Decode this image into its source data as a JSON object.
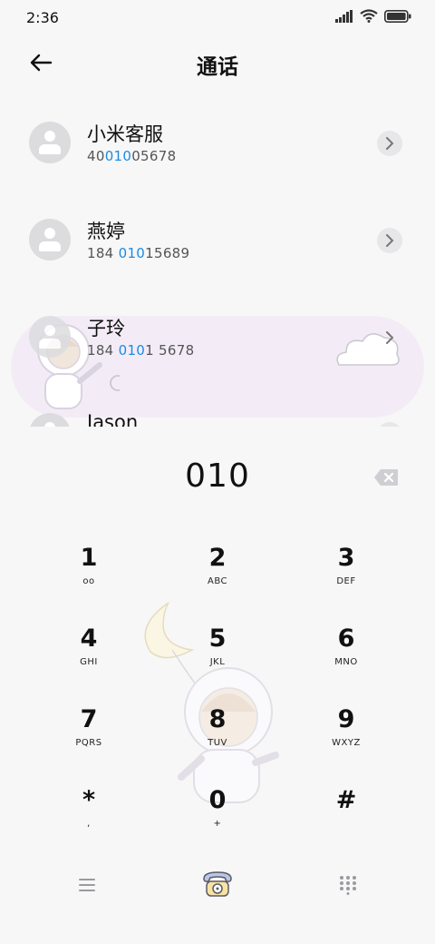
{
  "status": {
    "time": "2:36"
  },
  "header": {
    "title": "通话"
  },
  "contacts": [
    {
      "name": "小米客服",
      "number_pre": "40",
      "number_hl": "010",
      "number_post": "05678"
    },
    {
      "name": "燕婷",
      "number_pre": "184 ",
      "number_hl": "010",
      "number_post": "15689"
    },
    {
      "name": "子玲",
      "number_pre": "184 ",
      "number_hl": "010",
      "number_post": "1 5678"
    },
    {
      "name": "Jason",
      "number_pre": "",
      "number_hl": "",
      "number_post": ""
    }
  ],
  "dial": {
    "digits": "010"
  },
  "keypad": [
    {
      "num": "1",
      "letters": "ᴏᴏ"
    },
    {
      "num": "2",
      "letters": "ABC"
    },
    {
      "num": "3",
      "letters": "DEF"
    },
    {
      "num": "4",
      "letters": "GHI"
    },
    {
      "num": "5",
      "letters": "JKL"
    },
    {
      "num": "6",
      "letters": "MNO"
    },
    {
      "num": "7",
      "letters": "PQRS"
    },
    {
      "num": "8",
      "letters": "TUV"
    },
    {
      "num": "9",
      "letters": "WXYZ"
    },
    {
      "num": "*",
      "letters": ","
    },
    {
      "num": "0",
      "letters": "+"
    },
    {
      "num": "#",
      "letters": ""
    }
  ],
  "icons": {
    "back": "arrow-left-icon",
    "chevron": "chevron-right-icon",
    "backspace": "backspace-icon",
    "menu": "menu-icon",
    "call": "phone-icon",
    "dialpad": "dialpad-icon"
  },
  "colors": {
    "highlight": "#1a8be4",
    "bubble": "#f3ecf6"
  }
}
